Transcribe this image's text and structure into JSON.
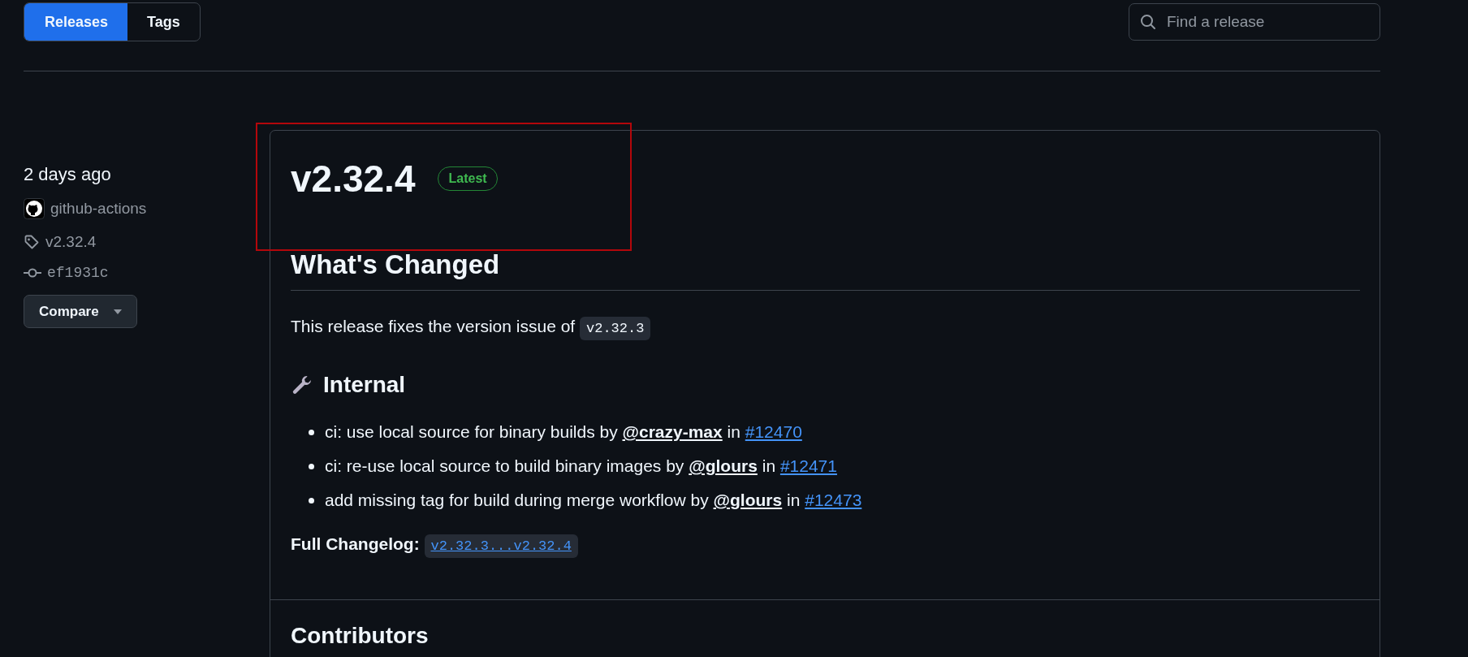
{
  "tabs": [
    {
      "label": "Releases",
      "selected": true
    },
    {
      "label": "Tags",
      "selected": false
    }
  ],
  "search": {
    "placeholder": "Find a release"
  },
  "release": {
    "time": "2 days ago",
    "author": "github-actions",
    "tag": "v2.32.4",
    "commit": "ef1931c",
    "compare_button": "Compare",
    "title": "v2.32.4",
    "badge": "Latest",
    "heading": "What's Changed",
    "intro": {
      "text": "This release fixes the version issue of",
      "code": "v2.32.3"
    },
    "section": {
      "title": "Internal",
      "items": [
        {
          "text": "ci: use local source for binary builds by",
          "author": "@crazy-max",
          "joiner": "in",
          "pr": "#12470"
        },
        {
          "text": "ci: re-use local source to build binary images by",
          "author": "@glours",
          "joiner": "in",
          "pr": "#12471"
        },
        {
          "text": "add missing tag for build during merge workflow by",
          "author": "@glours",
          "joiner": "in",
          "pr": "#12473"
        }
      ]
    },
    "changelog": {
      "label": "Full Changelog:",
      "link": "v2.32.3...v2.32.4"
    },
    "contributors_heading": "Contributors"
  }
}
